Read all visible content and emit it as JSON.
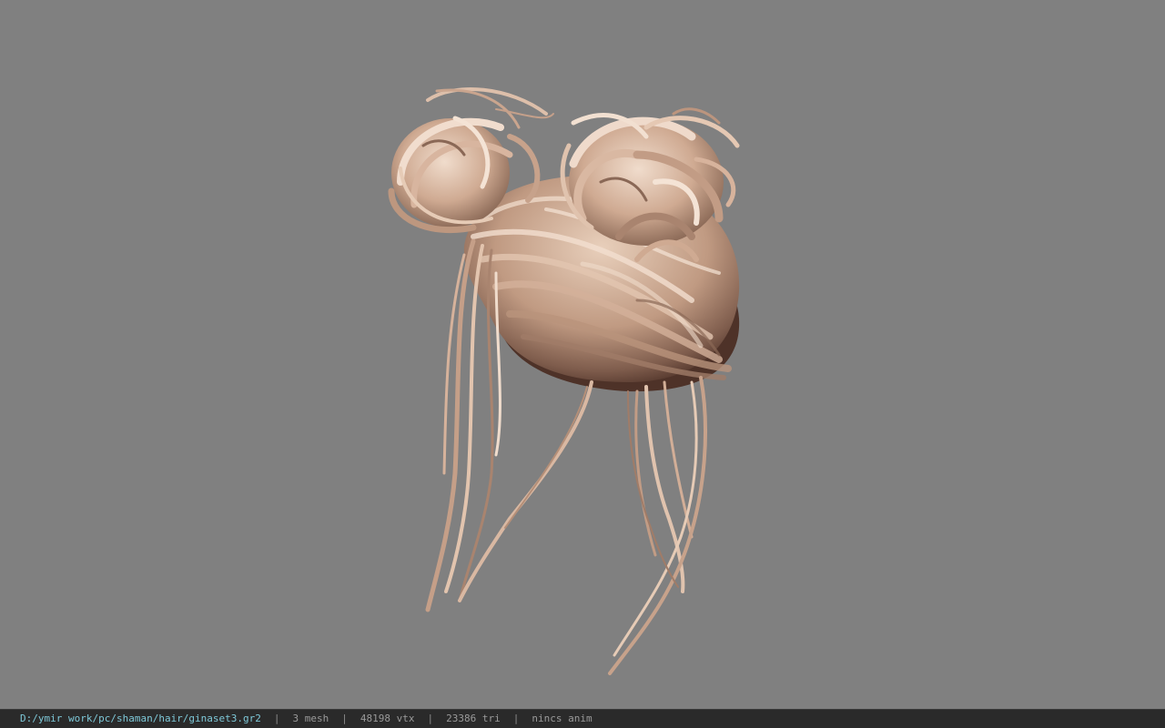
{
  "viewport": {
    "background": "#808080",
    "model": "hair-mesh",
    "hair_colors": {
      "light": "#e6cbb6",
      "mid": "#c9a48c",
      "dark": "#8a6856",
      "shadow": "#4e3228"
    }
  },
  "statusbar": {
    "file_path": "D:/ymir work/pc/shaman/hair/ginaset3.gr2",
    "separator": "|",
    "mesh_count": "3 mesh",
    "vertex_count": "48198 vtx",
    "triangle_count": "23386 tri",
    "anim_status": "nincs anim",
    "path_color": "#7ec8d8"
  }
}
